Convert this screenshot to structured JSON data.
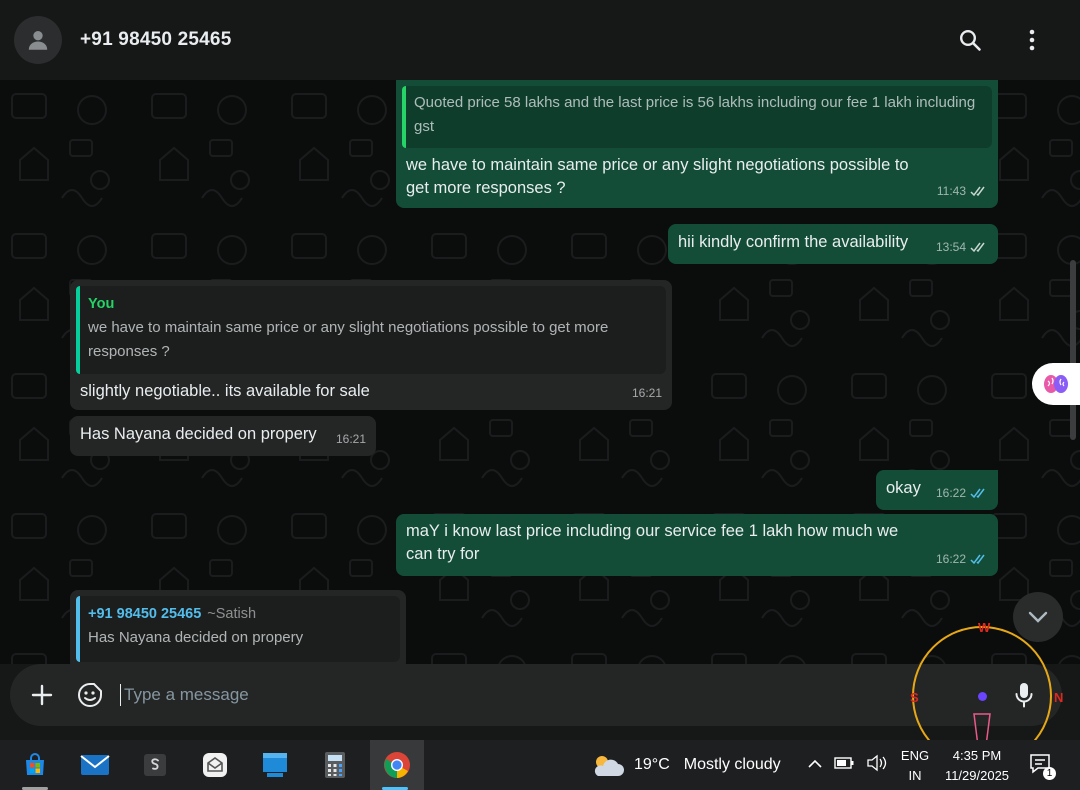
{
  "header": {
    "contact_name": "+91 98450 25465"
  },
  "messages": [
    {
      "type": "outgoing",
      "quote_text": "Quoted price 58 lakhs and the last price is 56 lakhs including our fee 1 lakh including gst",
      "text": "we have to maintain same price or any slight negotiations possible to get more responses ?",
      "time": "11:43"
    },
    {
      "type": "outgoing",
      "text": "hii kindly confirm the availability",
      "time": "13:54"
    },
    {
      "type": "incoming",
      "quote_author": "You",
      "quote_text": "we have to maintain same price or any slight negotiations possible to get more responses ?",
      "text": "slightly negotiable..  its available for sale",
      "time": "16:21"
    },
    {
      "type": "incoming",
      "text": "Has Nayana decided on propery",
      "time": "16:21"
    },
    {
      "type": "outgoing",
      "text": "okay",
      "time": "16:22"
    },
    {
      "type": "outgoing",
      "text": "maY i know last price including our service fee 1 lakh how much we can try for",
      "time": "16:22"
    },
    {
      "type": "incoming",
      "quote_author": "+91 98450 25465",
      "quote_author_sub": "~Satish",
      "quote_text": "Has Nayana decided on propery"
    }
  ],
  "composer": {
    "placeholder": "Type a message"
  },
  "compass": {
    "n": "W",
    "w": "S",
    "e": "N"
  },
  "taskbar": {
    "weather_temp": "19°C",
    "weather_text": "Mostly cloudy",
    "lang_top": "ENG",
    "lang_bottom": "IN",
    "time": "4:35 PM",
    "date": "11/29/2025",
    "notification_count": "1"
  },
  "colors": {
    "outgoing_bubble": "#134d37",
    "incoming_bubble": "#242626",
    "read_ticks": "#53bdeb",
    "accent_green": "#25d366"
  }
}
